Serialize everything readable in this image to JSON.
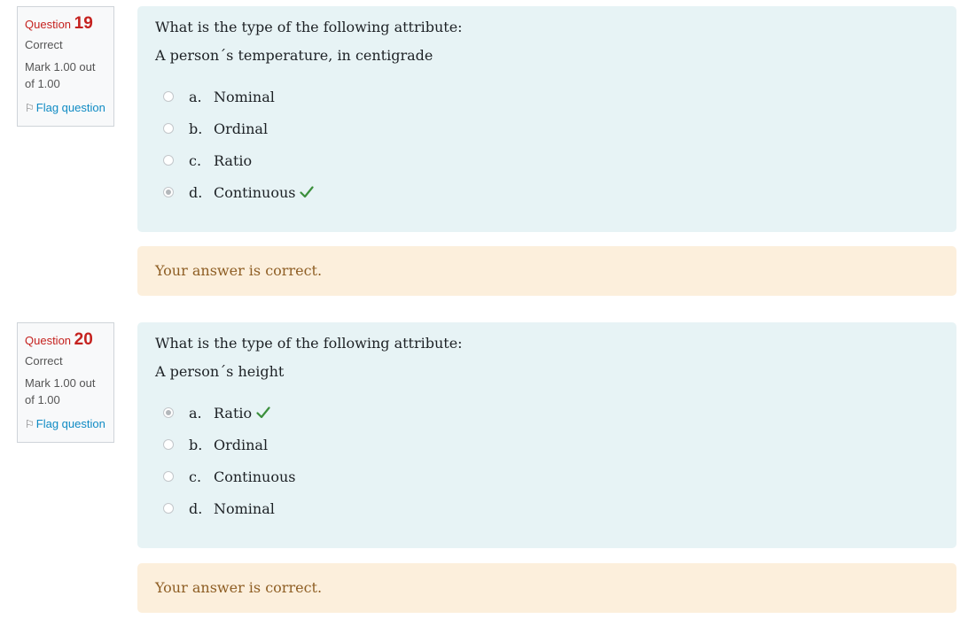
{
  "questions": [
    {
      "label": "Question",
      "number": "19",
      "state": "Correct",
      "mark": "Mark 1.00 out of 1.00",
      "flag_label": "Flag question",
      "prompt": "What is the type of the following attribute:",
      "subject": "A person´s temperature, in centigrade",
      "options": [
        {
          "letter": "a.",
          "text": "Nominal",
          "selected": false,
          "correct": false
        },
        {
          "letter": "b.",
          "text": "Ordinal",
          "selected": false,
          "correct": false
        },
        {
          "letter": "c.",
          "text": "Ratio",
          "selected": false,
          "correct": false
        },
        {
          "letter": "d.",
          "text": "Continuous",
          "selected": true,
          "correct": true
        }
      ],
      "feedback": "Your answer is correct."
    },
    {
      "label": "Question",
      "number": "20",
      "state": "Correct",
      "mark": "Mark 1.00 out of 1.00",
      "flag_label": "Flag question",
      "prompt": "What is the type of the following attribute:",
      "subject": "A person´s height",
      "options": [
        {
          "letter": "a.",
          "text": "Ratio",
          "selected": true,
          "correct": true
        },
        {
          "letter": "b.",
          "text": "Ordinal",
          "selected": false,
          "correct": false
        },
        {
          "letter": "c.",
          "text": "Continuous",
          "selected": false,
          "correct": false
        },
        {
          "letter": "d.",
          "text": "Nominal",
          "selected": false,
          "correct": false
        }
      ],
      "feedback": "Your answer is correct."
    }
  ],
  "colors": {
    "question_number": "#c5221f",
    "formulation_bg": "#e7f3f5",
    "feedback_bg": "#fcefdc",
    "feedback_text": "#8e5e24",
    "check": "#3b8f3c",
    "link": "#0f8bc4"
  },
  "icons": {
    "flag": "flag-icon",
    "correct": "check-icon"
  }
}
